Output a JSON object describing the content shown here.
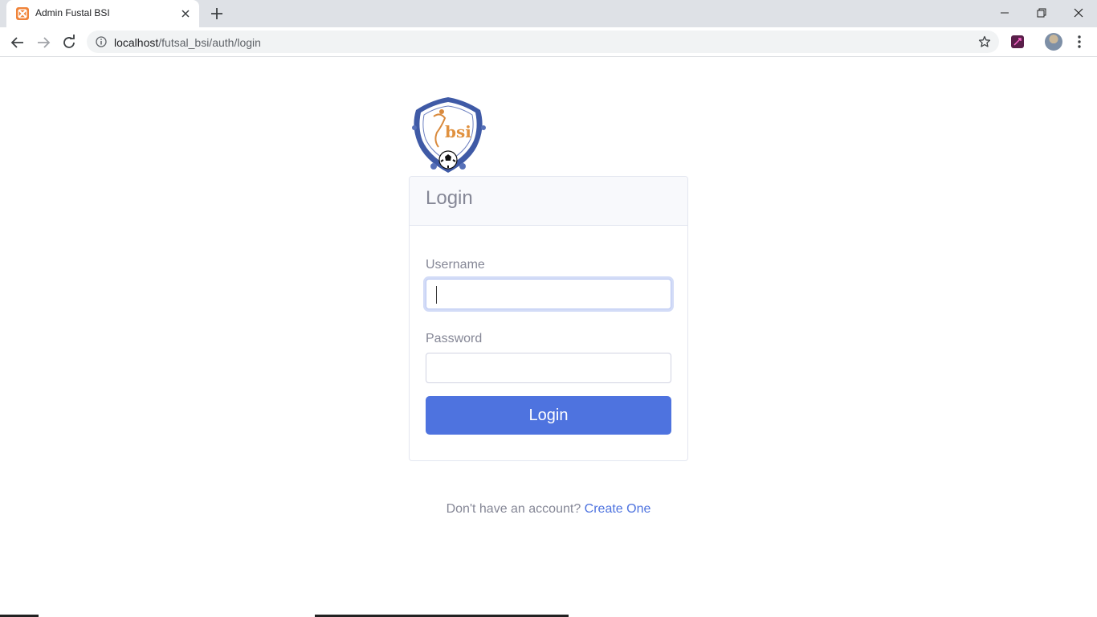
{
  "browser": {
    "tab_title": "Admin Fustal BSI",
    "url_host": "localhost",
    "url_path": "/futsal_bsi/auth/login",
    "favicon_color": "#f0843a"
  },
  "login_card": {
    "title": "Login",
    "username_label": "Username",
    "username_value": "",
    "password_label": "Password",
    "password_value": "",
    "submit_label": "Login"
  },
  "footer": {
    "prompt": "Don't have an account?",
    "link_label": "Create One"
  },
  "colors": {
    "primary": "#4e73df",
    "muted_text": "#858796",
    "card_header_bg": "#f8f9fc",
    "border": "#e3e6f0"
  }
}
